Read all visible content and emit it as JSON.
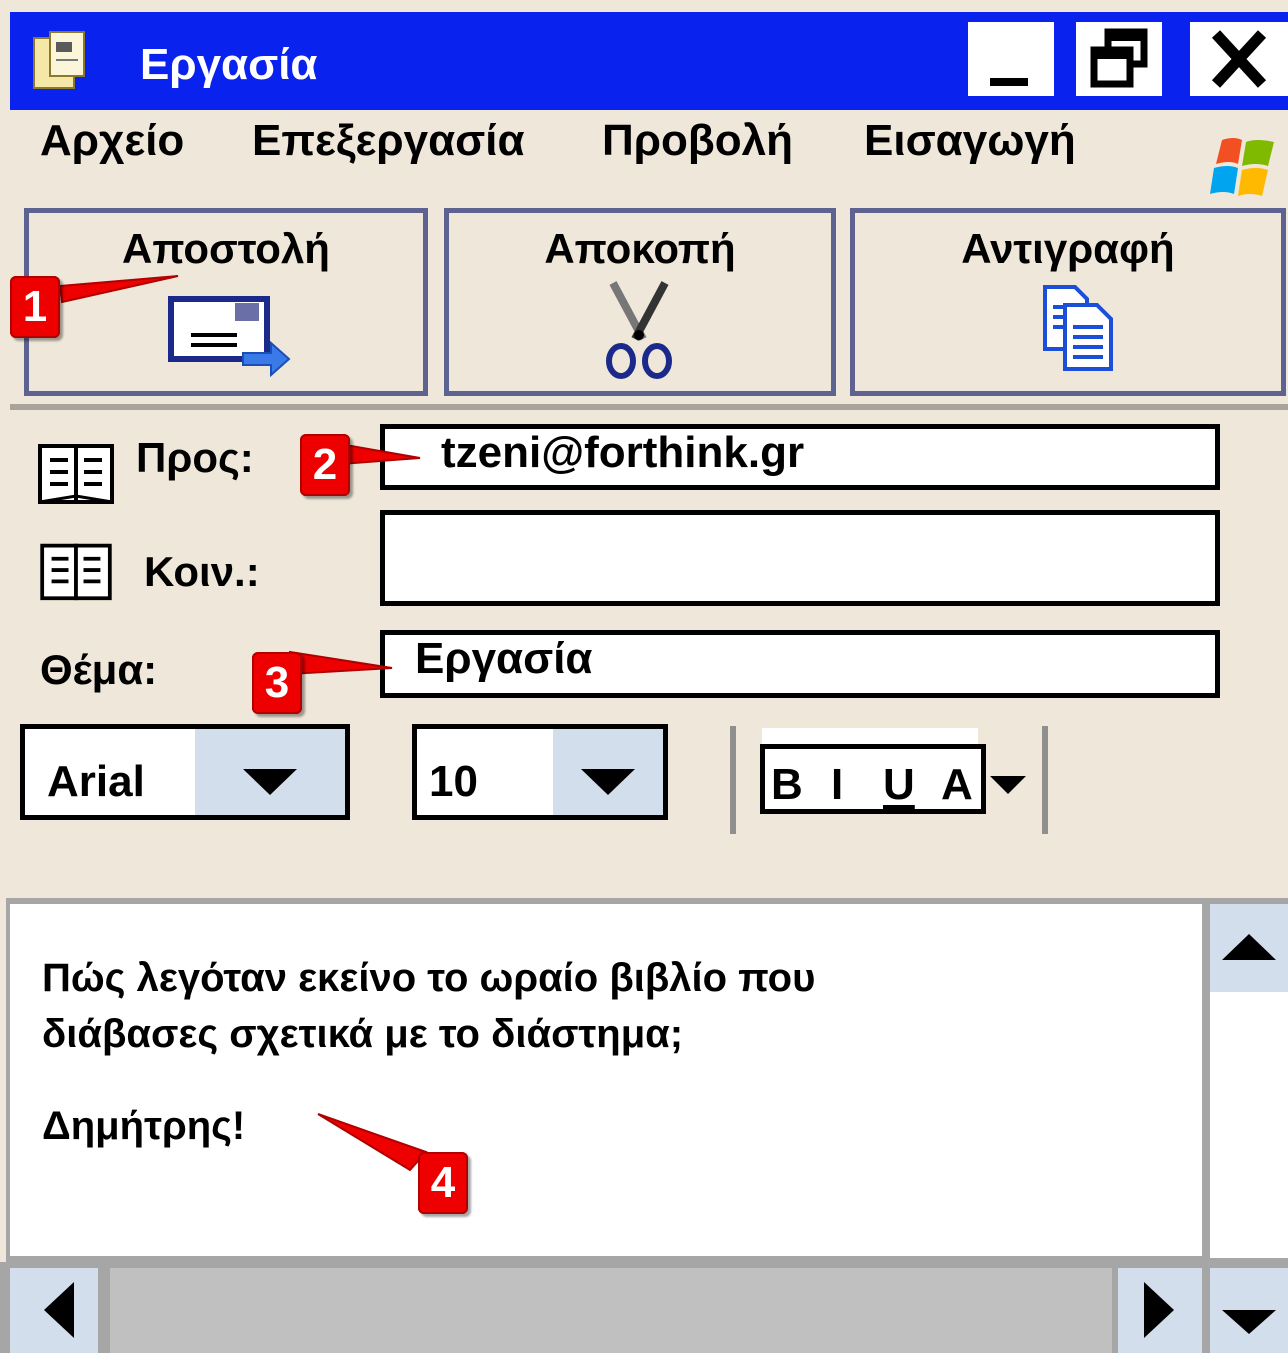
{
  "window": {
    "title": "Εργασία"
  },
  "titlebar_buttons": {
    "minimize": "minimize-icon",
    "restore": "restore-icon",
    "close": "close-icon"
  },
  "menu": {
    "items": [
      "Αρχείο",
      "Επεξεργασία",
      "Προβολή",
      "Εισαγωγή"
    ]
  },
  "toolbar": {
    "send_label": "Αποστολή",
    "cut_label": "Αποκοπή",
    "copy_label": "Αντιγραφή"
  },
  "fields": {
    "to_label": "Προς:",
    "to_value": "tzeni@forthink.gr",
    "cc_label": "Κοιν.:",
    "cc_value": "",
    "subject_label": "Θέμα:",
    "subject_value": "Εργασία"
  },
  "format": {
    "font": "Arial",
    "size": "10",
    "bold": "B",
    "italic": "I",
    "underline": "U",
    "color": "A"
  },
  "message": {
    "line1": "Πώς λεγόταν εκείνο το ωραίο βιβλίο που",
    "line2": "διάβασες σχετικά  με το διάστημα;",
    "line3": "Δημήτρης!"
  },
  "callouts": [
    "1",
    "2",
    "3",
    "4"
  ],
  "colors": {
    "titlebar": "#0a22ee",
    "window_bg": "#efe7d9",
    "callout": "#ee0000",
    "toolbar_border": "#5e6291",
    "scroll_button": "#d3deec"
  }
}
